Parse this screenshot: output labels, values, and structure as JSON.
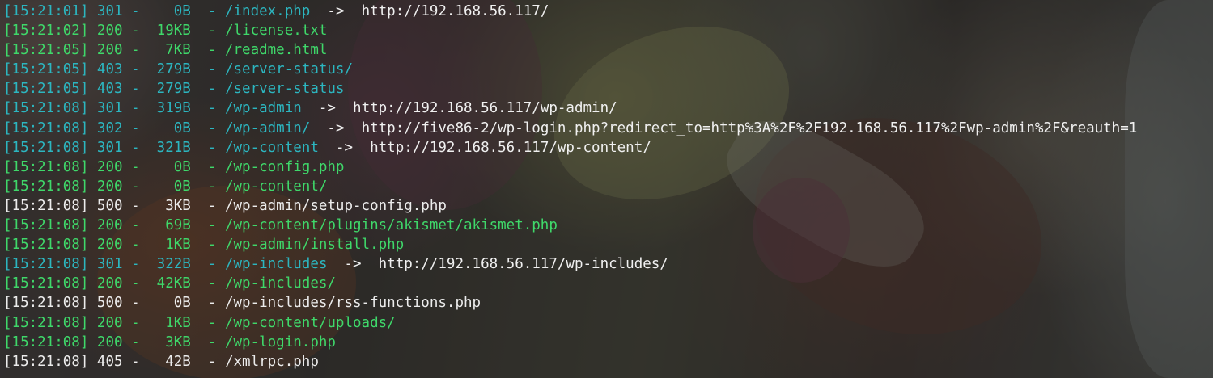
{
  "colors": {
    "redirect_status": "#2cb6c0",
    "success_status": "#3fd86a",
    "error_status": "#ececec",
    "redirect_target_text": "#f0f0f0"
  },
  "log": [
    {
      "time": "[15:21:01]",
      "status": "301",
      "size": "0B",
      "path": "/index.php",
      "arrow": "->",
      "target": "http://192.168.56.117/"
    },
    {
      "time": "[15:21:02]",
      "status": "200",
      "size": "19KB",
      "path": "/license.txt"
    },
    {
      "time": "[15:21:05]",
      "status": "200",
      "size": "7KB",
      "path": "/readme.html"
    },
    {
      "time": "[15:21:05]",
      "status": "403",
      "size": "279B",
      "path": "/server-status/"
    },
    {
      "time": "[15:21:05]",
      "status": "403",
      "size": "279B",
      "path": "/server-status"
    },
    {
      "time": "[15:21:08]",
      "status": "301",
      "size": "319B",
      "path": "/wp-admin",
      "arrow": "->",
      "target": "http://192.168.56.117/wp-admin/"
    },
    {
      "time": "[15:21:08]",
      "status": "302",
      "size": "0B",
      "path": "/wp-admin/",
      "arrow": "->",
      "target": "http://five86-2/wp-login.php?redirect_to=http%3A%2F%2F192.168.56.117%2Fwp-admin%2F&reauth=1"
    },
    {
      "time": "[15:21:08]",
      "status": "301",
      "size": "321B",
      "path": "/wp-content",
      "arrow": "->",
      "target": "http://192.168.56.117/wp-content/"
    },
    {
      "time": "[15:21:08]",
      "status": "200",
      "size": "0B",
      "path": "/wp-config.php"
    },
    {
      "time": "[15:21:08]",
      "status": "200",
      "size": "0B",
      "path": "/wp-content/"
    },
    {
      "time": "[15:21:08]",
      "status": "500",
      "size": "3KB",
      "path": "/wp-admin/setup-config.php"
    },
    {
      "time": "[15:21:08]",
      "status": "200",
      "size": "69B",
      "path": "/wp-content/plugins/akismet/akismet.php"
    },
    {
      "time": "[15:21:08]",
      "status": "200",
      "size": "1KB",
      "path": "/wp-admin/install.php"
    },
    {
      "time": "[15:21:08]",
      "status": "301",
      "size": "322B",
      "path": "/wp-includes",
      "arrow": "->",
      "target": "http://192.168.56.117/wp-includes/"
    },
    {
      "time": "[15:21:08]",
      "status": "200",
      "size": "42KB",
      "path": "/wp-includes/"
    },
    {
      "time": "[15:21:08]",
      "status": "500",
      "size": "0B",
      "path": "/wp-includes/rss-functions.php"
    },
    {
      "time": "[15:21:08]",
      "status": "200",
      "size": "1KB",
      "path": "/wp-content/uploads/"
    },
    {
      "time": "[15:21:08]",
      "status": "200",
      "size": "3KB",
      "path": "/wp-login.php"
    },
    {
      "time": "[15:21:08]",
      "status": "405",
      "size": "42B",
      "path": "/xmlrpc.php"
    }
  ]
}
